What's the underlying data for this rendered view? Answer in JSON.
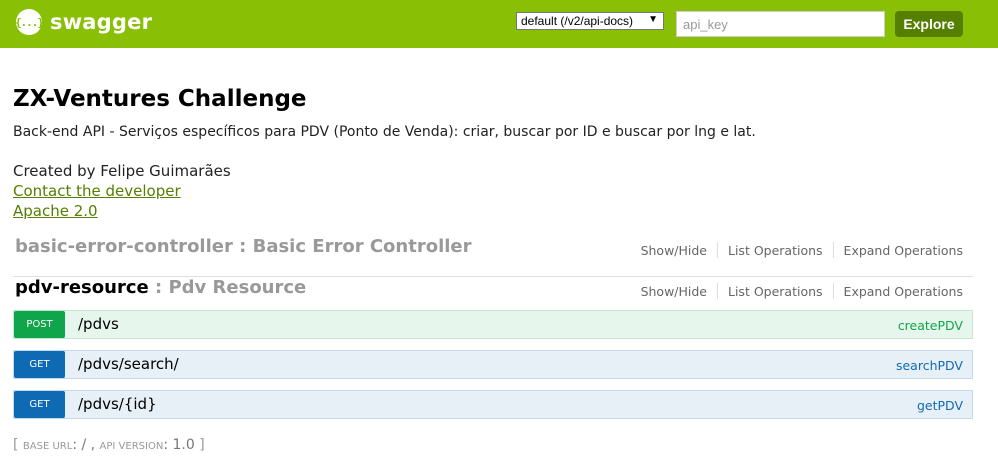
{
  "header": {
    "logo_glyph": "{...}",
    "logo_text": "swagger",
    "spec_selected": "default (/v2/api-docs)",
    "api_key_placeholder": "api_key",
    "explore_label": "Explore",
    "brand_color": "#89bf04"
  },
  "info": {
    "title": "ZX-Ventures Challenge",
    "description": "Back-end API - Serviços específicos para PDV (Ponto de Venda): criar, buscar por ID e buscar por lng e lat.",
    "created_by": "Created by Felipe Guimarães",
    "contact_link": "Contact the developer",
    "license_link": "Apache 2.0"
  },
  "resources": [
    {
      "name": "basic-error-controller",
      "separator": " : ",
      "description": "Basic Error Controller",
      "ops": [
        "Show/Hide",
        "List Operations",
        "Expand Operations"
      ]
    },
    {
      "name": "pdv-resource",
      "separator": " : ",
      "description": "Pdv Resource",
      "ops": [
        "Show/Hide",
        "List Operations",
        "Expand Operations"
      ]
    }
  ],
  "endpoints": [
    {
      "method": "POST",
      "path": "/pdvs",
      "operation": "createPDV"
    },
    {
      "method": "GET",
      "path": "/pdvs/search/",
      "operation": "searchPDV"
    },
    {
      "method": "GET",
      "path": "/pdvs/{id}",
      "operation": "getPDV"
    }
  ],
  "footer": {
    "open": "[ ",
    "base_url_label": "base url",
    "base_url_value": ": / , ",
    "api_version_label": "api version",
    "api_version_value": ": 1.0",
    "close": " ]"
  }
}
